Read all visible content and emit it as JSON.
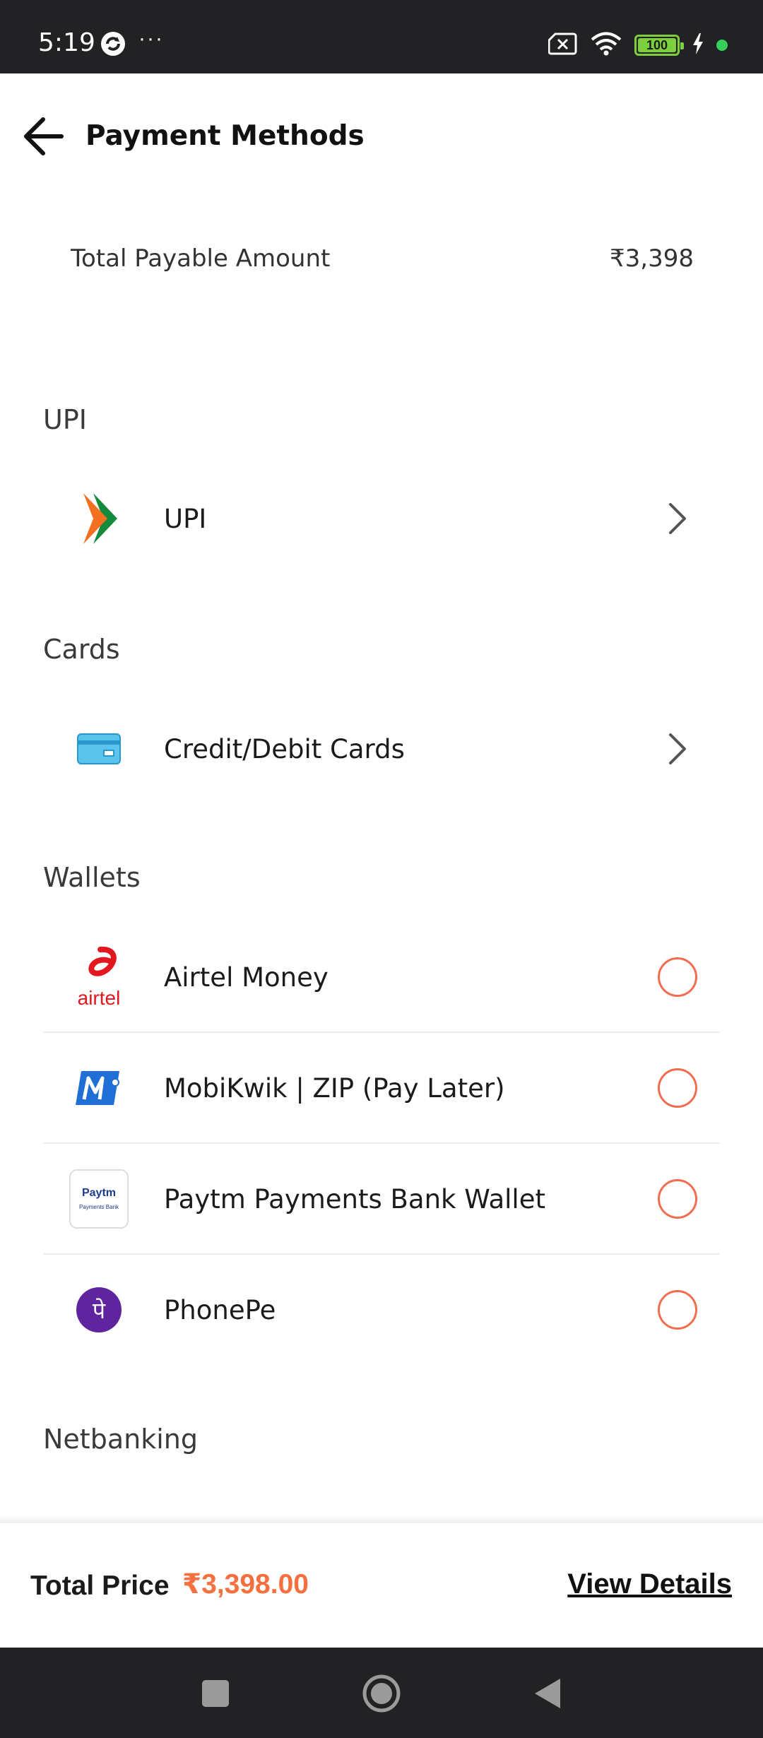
{
  "status_bar": {
    "time": "5:19",
    "dots": "···",
    "battery": "100"
  },
  "header": {
    "title": "Payment Methods"
  },
  "summary": {
    "label": "Total Payable Amount",
    "amount": "₹3,398"
  },
  "sections": {
    "upi": {
      "title": "UPI",
      "item_label": "UPI"
    },
    "cards": {
      "title": "Cards",
      "item_label": "Credit/Debit Cards"
    },
    "wallets": {
      "title": "Wallets",
      "items": [
        {
          "label": "Airtel Money",
          "icon": "airtel-icon"
        },
        {
          "label": "MobiKwik | ZIP (Pay Later)",
          "icon": "mobikwik-icon"
        },
        {
          "label": "Paytm Payments Bank Wallet",
          "icon": "paytm-icon"
        },
        {
          "label": "PhonePe",
          "icon": "phonepe-icon"
        }
      ]
    },
    "netbanking": {
      "title": "Netbanking"
    }
  },
  "price_bar": {
    "label": "Total Price",
    "value": "₹3,398.00",
    "details_link": "View Details"
  },
  "colors": {
    "accent": "#f56f3f",
    "radio": "#f26c4f",
    "system_bar": "#222224"
  },
  "logo_text": {
    "airtel": "airtel",
    "paytm_top": "Paytm",
    "paytm_bottom": "Payments Bank",
    "phonepe": "पे"
  }
}
